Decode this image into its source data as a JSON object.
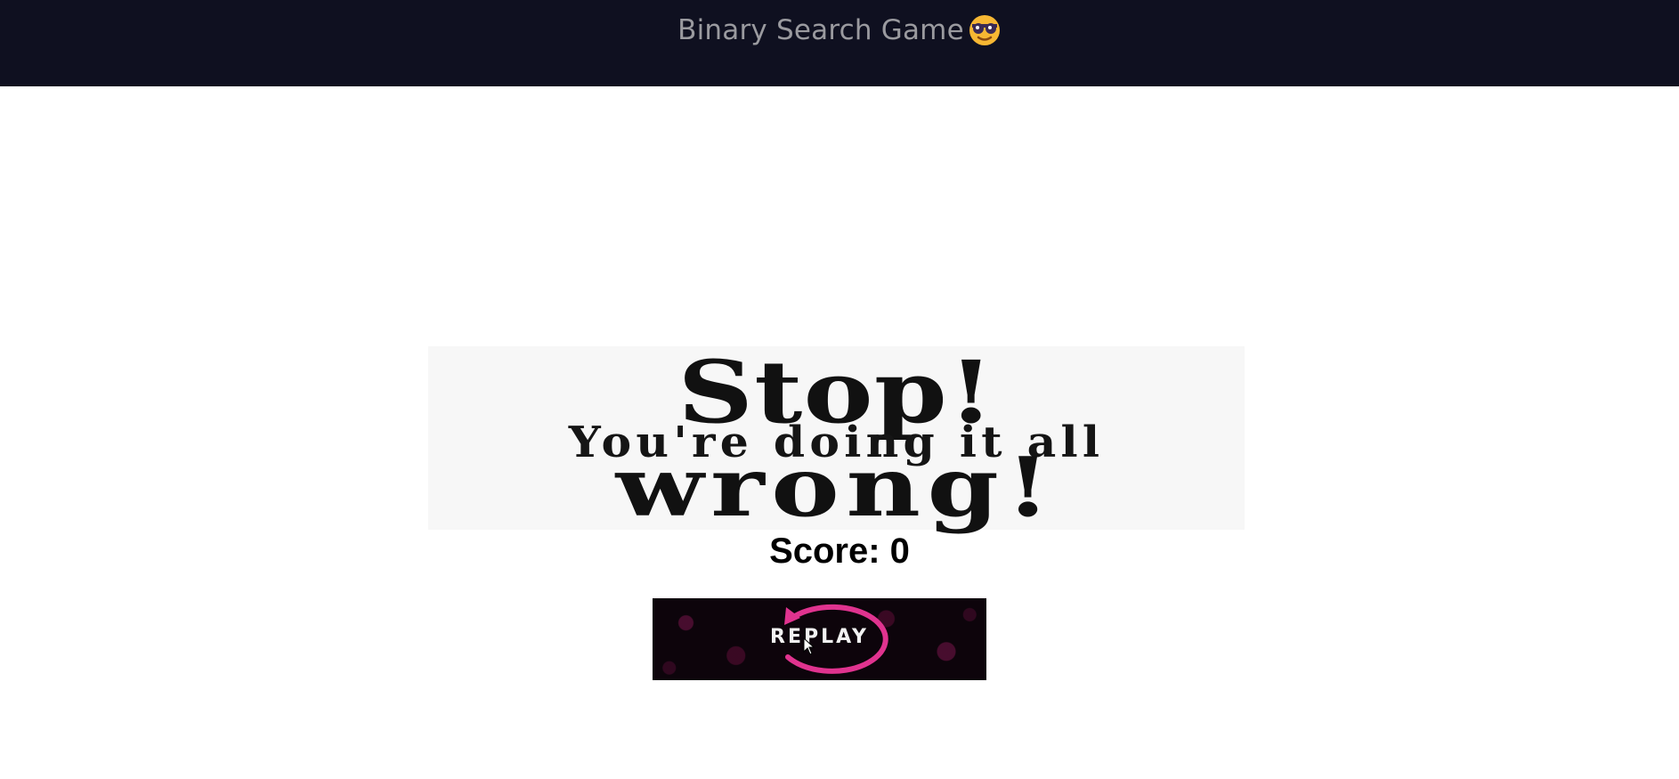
{
  "header": {
    "title": "Binary Search Game",
    "emoji_icon": "smiling-face-with-sunglasses-icon"
  },
  "banner": {
    "line1": "Stop!",
    "line2": "You're doing it all",
    "line3": "wrong!"
  },
  "score": {
    "text": "Score: 0"
  },
  "replay": {
    "label": "REPLAY",
    "icon": "replay-arrow-icon",
    "accent_color": "#e0338f"
  },
  "colors": {
    "topbar": "#0f1020",
    "title_text": "#9a9a9f",
    "button_bg": "#0d040b"
  }
}
